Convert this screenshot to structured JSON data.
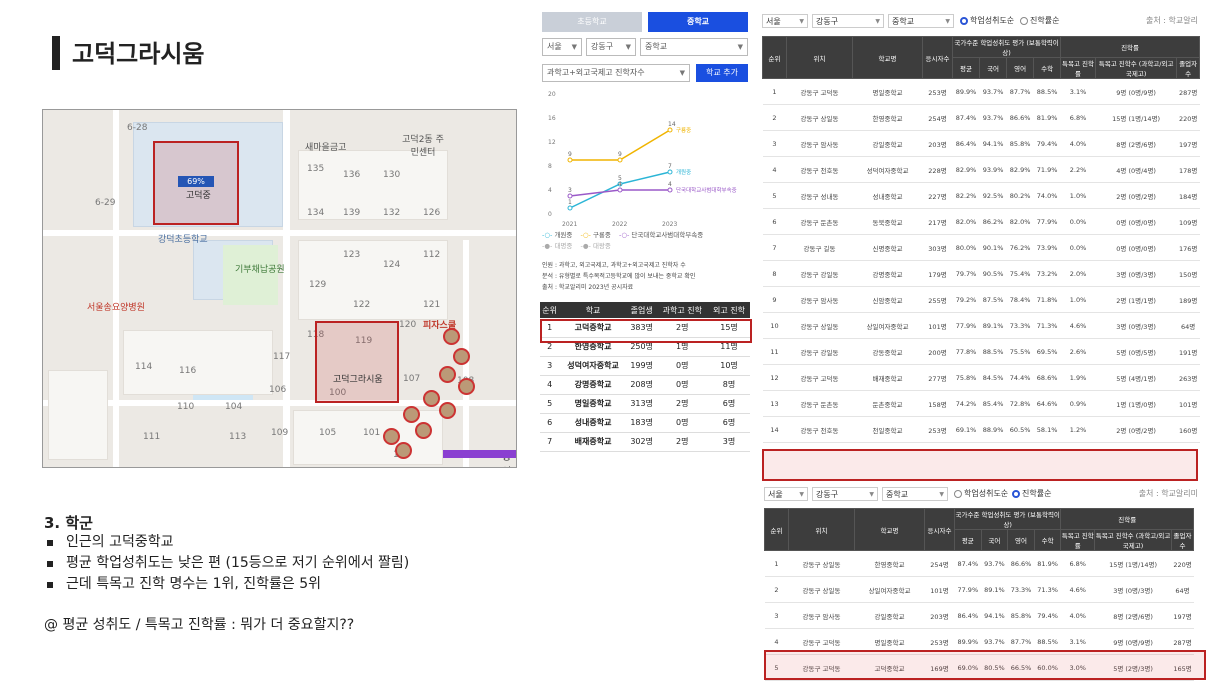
{
  "slide": {
    "title": "고덕그라시움",
    "section_heading": "3. 학군",
    "bullets": [
      "인근의 고덕중학교",
      "평균 학업성취도는 낮은 편 (15등으로 저기 순위에서 짤림)",
      "근데 특목고 진학 명수는 1위, 진학률은 5위"
    ],
    "question": "@ 평균 성취도 / 특목고 진학률 : 뭐가 더 중요할지??"
  },
  "map": {
    "labels": {
      "school_label": "고덕중",
      "school_badge": "69%",
      "elementary": "강덕초등학교",
      "park": "기부채납공원",
      "hospital": "서울송요양병원",
      "bank": "새마을금고",
      "center": "고덕2동 주민센터",
      "apartment": "고덕그라시움",
      "pizza": "피자스쿨",
      "stop1": "6-28",
      "stop2": "6-29",
      "edge": "상일"
    },
    "block_numbers": [
      "135",
      "136",
      "134",
      "130",
      "132",
      "139",
      "126",
      "123",
      "124",
      "129",
      "114",
      "116",
      "112",
      "122",
      "121",
      "118",
      "117",
      "119",
      "120",
      "106",
      "100",
      "107",
      "108",
      "109",
      "105",
      "101",
      "103",
      "110",
      "104",
      "111",
      "113"
    ]
  },
  "widget": {
    "tabs": [
      {
        "label": "초등학교",
        "active": false
      },
      {
        "label": "중학교",
        "active": true
      }
    ],
    "selects": [
      "서울",
      "강동구",
      "중학교"
    ],
    "metric_select": "과학고+외고국제고 진학자수",
    "add_button": "학교 추가",
    "chart_note_lines": [
      "인원 : 과학고, 외고국제고, 과학고+외고국제고 진학자 수",
      "분석 : 유형별로 특수목적고등학교에 많이 보내는 중학교 확인",
      "출처 : 학교알리미 2023년 공시자료"
    ],
    "legend": [
      {
        "name": "개원중",
        "color": "#2bb5d6"
      },
      {
        "name": "구룡중",
        "color": "#f0b400"
      },
      {
        "name": "단국대학교사범대학부속중",
        "color": "#9a59c8"
      },
      {
        "name": "대명중",
        "color": "#bbbbbb"
      },
      {
        "name": "대왕중",
        "color": "#bbbbbb"
      }
    ],
    "table_headers": [
      "순위",
      "학교",
      "졸업생",
      "과학고 진학",
      "외고 진학"
    ],
    "table_rows": [
      [
        "1",
        "고덕중학교",
        "383명",
        "2명",
        "15명"
      ],
      [
        "2",
        "한영중학교",
        "250명",
        "1명",
        "11명"
      ],
      [
        "3",
        "성덕여자중학교",
        "199명",
        "0명",
        "10명"
      ],
      [
        "4",
        "강명중학교",
        "208명",
        "0명",
        "8명"
      ],
      [
        "5",
        "명일중학교",
        "313명",
        "2명",
        "6명"
      ],
      [
        "6",
        "성내중학교",
        "183명",
        "0명",
        "6명"
      ],
      [
        "7",
        "배재중학교",
        "302명",
        "2명",
        "3명"
      ]
    ]
  },
  "chart_data": {
    "type": "line",
    "x": [
      "2021",
      "2022",
      "2023"
    ],
    "ylim": [
      0,
      20
    ],
    "yticks": [
      0,
      4,
      8,
      12,
      16,
      20
    ],
    "series": [
      {
        "name": "구룡중",
        "values": [
          9,
          9,
          14
        ],
        "color": "#f0b400"
      },
      {
        "name": "개원중",
        "values": [
          1,
          5,
          7
        ],
        "color": "#2bb5d6"
      },
      {
        "name": "단국대학교사범대학부속중",
        "values": [
          3,
          4,
          4
        ],
        "color": "#9a59c8"
      }
    ]
  },
  "top_table": {
    "filters": {
      "city": "서울",
      "district": "강동구",
      "level": "중학교",
      "radio1": "학업성취도순",
      "radio2": "진학률순",
      "source": "출처 : 학교알리"
    },
    "group_headers": {
      "national": "국가수준 학업성취도 평가 (보통학력이상)",
      "admission": "진학률"
    },
    "headers": [
      "순위",
      "위치",
      "학교명",
      "응시자수",
      "평균",
      "국어",
      "영어",
      "수학",
      "특목고 진학률",
      "특목고 진학수 (과학고/외고국제고)",
      "졸업자수"
    ],
    "rows": [
      [
        "1",
        "강동구 고덕동",
        "명일중학교",
        "253명",
        "89.9%",
        "93.7%",
        "87.7%",
        "88.5%",
        "3.1%",
        "9명 (0명/9명)",
        "287명"
      ],
      [
        "2",
        "강동구 상일동",
        "한영중학교",
        "254명",
        "87.4%",
        "93.7%",
        "86.6%",
        "81.9%",
        "6.8%",
        "15명 (1명/14명)",
        "220명"
      ],
      [
        "3",
        "강동구 암사동",
        "강일중학교",
        "203명",
        "86.4%",
        "94.1%",
        "85.8%",
        "79.4%",
        "4.0%",
        "8명 (2명/6명)",
        "197명"
      ],
      [
        "4",
        "강동구 천호동",
        "성덕여자중학교",
        "228명",
        "82.9%",
        "93.9%",
        "82.9%",
        "71.9%",
        "2.2%",
        "4명 (0명/4명)",
        "178명"
      ],
      [
        "5",
        "강동구 성내동",
        "성내중학교",
        "227명",
        "82.2%",
        "92.5%",
        "80.2%",
        "74.0%",
        "1.0%",
        "2명 (0명/2명)",
        "184명"
      ],
      [
        "6",
        "강동구 둔촌동",
        "동북중학교",
        "217명",
        "82.0%",
        "86.2%",
        "82.0%",
        "77.9%",
        "0.0%",
        "0명 (0명/0명)",
        "109명"
      ],
      [
        "7",
        "강동구 길동",
        "신명중학교",
        "303명",
        "80.0%",
        "90.1%",
        "76.2%",
        "73.9%",
        "0.0%",
        "0명 (0명/0명)",
        "176명"
      ],
      [
        "8",
        "강동구 강일동",
        "강명중학교",
        "179명",
        "79.7%",
        "90.5%",
        "75.4%",
        "73.2%",
        "2.0%",
        "3명 (0명/3명)",
        "150명"
      ],
      [
        "9",
        "강동구 암사동",
        "신암중학교",
        "255명",
        "79.2%",
        "87.5%",
        "78.4%",
        "71.8%",
        "1.0%",
        "2명 (1명/1명)",
        "189명"
      ],
      [
        "10",
        "강동구 상일동",
        "상일여자중학교",
        "101명",
        "77.9%",
        "89.1%",
        "73.3%",
        "71.3%",
        "4.6%",
        "3명 (0명/3명)",
        "64명"
      ],
      [
        "11",
        "강동구 강일동",
        "강동중학교",
        "200명",
        "77.8%",
        "88.5%",
        "75.5%",
        "69.5%",
        "2.6%",
        "5명 (0명/5명)",
        "191명"
      ],
      [
        "12",
        "강동구 고덕동",
        "배재중학교",
        "277명",
        "75.8%",
        "84.5%",
        "74.4%",
        "68.6%",
        "1.9%",
        "5명 (4명/1명)",
        "263명"
      ],
      [
        "13",
        "강동구 둔촌동",
        "둔촌중학교",
        "158명",
        "74.2%",
        "85.4%",
        "72.8%",
        "64.6%",
        "0.9%",
        "1명 (1명/0명)",
        "101명"
      ],
      [
        "14",
        "강동구 천호동",
        "천일중학교",
        "253명",
        "69.1%",
        "88.9%",
        "60.5%",
        "58.1%",
        "1.2%",
        "2명 (0명/2명)",
        "160명"
      ]
    ]
  },
  "bottom_table": {
    "filters": {
      "city": "서울",
      "district": "강동구",
      "level": "중학교",
      "radio1": "학업성취도순",
      "radio2": "진학률순",
      "source": "출처 : 학교알리미"
    },
    "group_headers": {
      "national": "국가수준 학업성취도 평가 (보통학력이상)",
      "admission": "진학률"
    },
    "headers": [
      "순위",
      "위치",
      "학교명",
      "응시자수",
      "평균",
      "국어",
      "영어",
      "수학",
      "특목고 진학률",
      "특목고 진학수 (과학고/외고국제고)",
      "졸업자수"
    ],
    "rows": [
      [
        "1",
        "강동구 상일동",
        "한영중학교",
        "254명",
        "87.4%",
        "93.7%",
        "86.6%",
        "81.9%",
        "6.8%",
        "15명 (1명/14명)",
        "220명"
      ],
      [
        "2",
        "강동구 상일동",
        "상일여자중학교",
        "101명",
        "77.9%",
        "89.1%",
        "73.3%",
        "71.3%",
        "4.6%",
        "3명 (0명/3명)",
        "64명"
      ],
      [
        "3",
        "강동구 암사동",
        "강일중학교",
        "203명",
        "86.4%",
        "94.1%",
        "85.8%",
        "79.4%",
        "4.0%",
        "8명 (2명/6명)",
        "197명"
      ],
      [
        "4",
        "강동구 고덕동",
        "명일중학교",
        "253명",
        "89.9%",
        "93.7%",
        "87.7%",
        "88.5%",
        "3.1%",
        "9명 (0명/9명)",
        "287명"
      ],
      [
        "5",
        "강동구 고덕동",
        "고덕중학교",
        "169명",
        "69.0%",
        "80.5%",
        "66.5%",
        "60.0%",
        "3.0%",
        "5명 (2명/3명)",
        "165명"
      ]
    ]
  }
}
